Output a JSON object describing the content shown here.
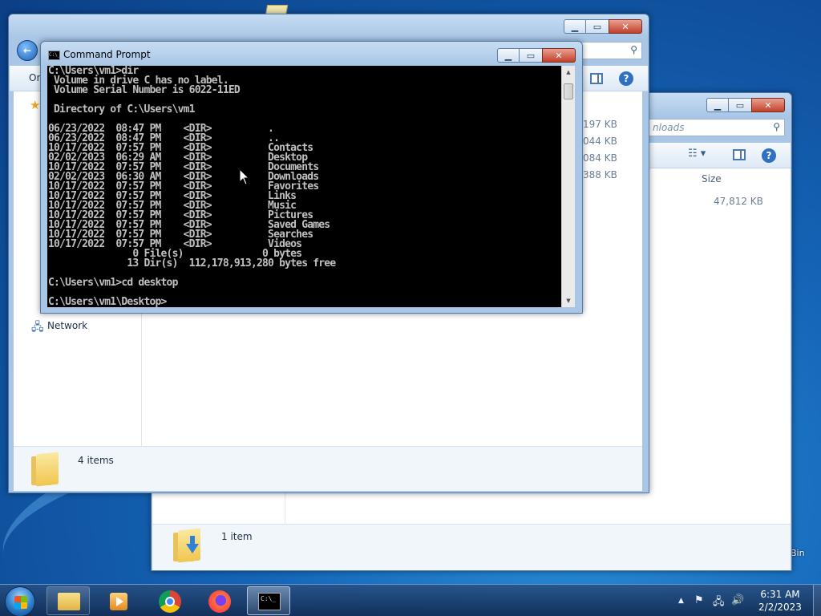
{
  "desktop": {
    "recycle_bin_label": "Bin"
  },
  "explorer_back": {
    "search_placeholder": "nloads",
    "column_size": "Size",
    "size_value": "47,812 KB",
    "status_text": "1 item"
  },
  "explorer_front": {
    "menu_organize": "Or",
    "nav_network": "Network",
    "sizes": [
      "197 KB",
      "044 KB",
      "084 KB",
      "388 KB"
    ],
    "status_text": "4 items"
  },
  "cmd": {
    "title": "Command Prompt",
    "icon_glyph": "C:\\_",
    "lines": [
      "C:\\Users\\vm1>dir",
      " Volume in drive C has no label.",
      " Volume Serial Number is 6022-11ED",
      "",
      " Directory of C:\\Users\\vm1",
      "",
      "06/23/2022  08:47 PM    <DIR>          .",
      "06/23/2022  08:47 PM    <DIR>          ..",
      "10/17/2022  07:57 PM    <DIR>          Contacts",
      "02/02/2023  06:29 AM    <DIR>          Desktop",
      "10/17/2022  07:57 PM    <DIR>          Documents",
      "02/02/2023  06:30 AM    <DIR>          Downloads",
      "10/17/2022  07:57 PM    <DIR>          Favorites",
      "10/17/2022  07:57 PM    <DIR>          Links",
      "10/17/2022  07:57 PM    <DIR>          Music",
      "10/17/2022  07:57 PM    <DIR>          Pictures",
      "10/17/2022  07:57 PM    <DIR>          Saved Games",
      "10/17/2022  07:57 PM    <DIR>          Searches",
      "10/17/2022  07:57 PM    <DIR>          Videos",
      "               0 File(s)              0 bytes",
      "              13 Dir(s)  112,178,913,280 bytes free",
      "",
      "C:\\Users\\vm1>cd desktop",
      "",
      "C:\\Users\\vm1\\Desktop>"
    ]
  },
  "taskbar": {
    "cmd_glyph": "C:\\_",
    "time": "6:31 AM",
    "date": "2/2/2023"
  },
  "colors": {
    "console_bg": "#000000",
    "console_fg": "#c0c0c0",
    "close_red": "#c2402b"
  }
}
